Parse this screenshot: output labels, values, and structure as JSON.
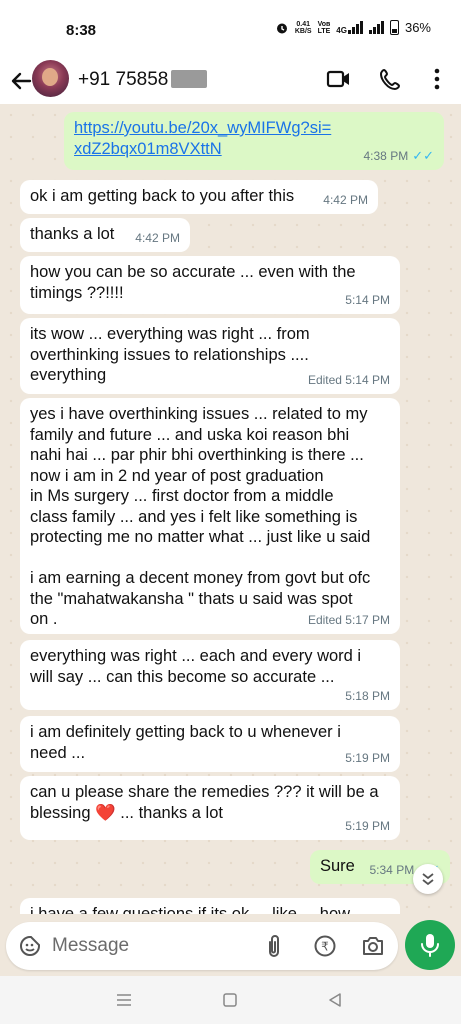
{
  "status": {
    "time": "8:38",
    "net_speed_value": "0.41",
    "net_speed_unit": "KB/S",
    "volte_top": "Voʙ",
    "volte_bottom": "LTE",
    "network": "4G",
    "battery": "36%"
  },
  "header": {
    "contact": "+91 75858",
    "icons": [
      "back-arrow-icon",
      "video-call-icon",
      "phone-icon",
      "more-vert-icon"
    ]
  },
  "messages": [
    {
      "dir": "out",
      "text": "https://youtu.be/20x_wyMIFWg?si=\nxdZ2bqx01m8VXttN",
      "meta": "4:38 PM",
      "status": "read"
    },
    {
      "dir": "in",
      "text": "ok i am getting back to you after this",
      "meta": "4:42 PM"
    },
    {
      "dir": "in",
      "text": "thanks a lot",
      "meta": "4:42 PM"
    },
    {
      "dir": "in",
      "text": "how you can be so accurate ... even with the\ntimings ??!!!!",
      "meta": "5:14 PM"
    },
    {
      "dir": "in",
      "text": "its wow ... everything was right ... from\noverthinking issues to relationships ....\neverything",
      "meta": "Edited 5:14 PM"
    },
    {
      "dir": "in",
      "text": "yes i have overthinking issues ... related to my\nfamily and future ... and uska koi reason bhi\nnahi hai ... par phir bhi overthinking is there ...\nnow i am in 2 nd year of post graduation\nin Ms surgery ... first doctor from a middle\nclass family ... and yes i felt like something is\nprotecting me no matter what ... just like u said\n\ni am earning a decent money from govt but ofc\nthe \"mahatwakansha \" thats u said was spot\non .",
      "meta": "Edited 5:17 PM"
    },
    {
      "dir": "in",
      "text": "everything was right ... each and every word i\nwill say ... can this become so accurate ...",
      "meta": "5:18 PM"
    },
    {
      "dir": "in",
      "text": "i am definitely getting back to u whenever i\nneed ...",
      "meta": "5:19 PM"
    },
    {
      "dir": "in",
      "text_before": "can u please share the remedies ??? it will be a\nblessing ",
      "emoji": "❤️",
      "text_after": " ... thanks a lot",
      "meta": "5:19 PM"
    },
    {
      "dir": "out",
      "text": "Sure",
      "meta": "5:34 PM",
      "status": "read"
    },
    {
      "dir": "in",
      "text": "i have a few questions if its ok ... like ... how",
      "meta": ""
    }
  ],
  "composer": {
    "placeholder": "Message",
    "icons": [
      "emoji-sticker-icon",
      "attach-icon",
      "rupee-payment-icon",
      "camera-icon",
      "mic-icon"
    ]
  },
  "colors": {
    "chat_bg": "#efe7dc",
    "incoming": "#ffffff",
    "outgoing": "#dcf8c6",
    "accent": "#1fa855",
    "read_ticks": "#34b7f1"
  }
}
